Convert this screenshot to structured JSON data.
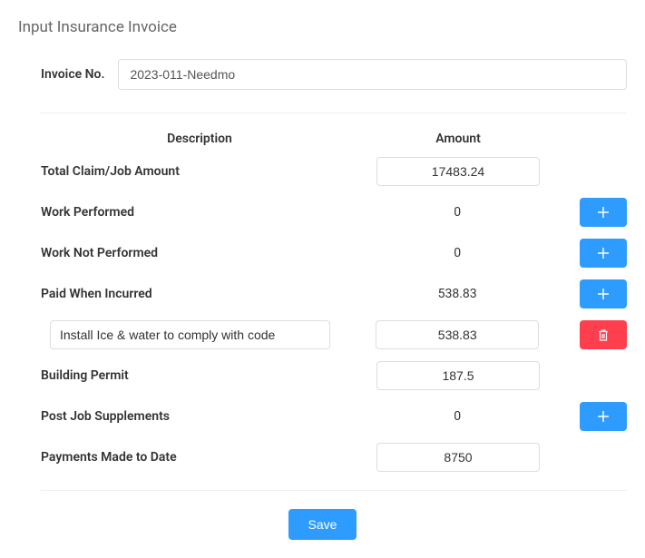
{
  "page_title": "Input Insurance Invoice",
  "invoice_no_label": "Invoice No.",
  "invoice_no_value": "2023-011-Needmo",
  "headers": {
    "description": "Description",
    "amount": "Amount"
  },
  "rows": {
    "total_claim": {
      "label": "Total Claim/Job Amount",
      "amount": "17483.24"
    },
    "work_performed": {
      "label": "Work Performed",
      "amount": "0"
    },
    "work_not_performed": {
      "label": "Work Not Performed",
      "amount": "0"
    },
    "paid_when_incurred": {
      "label": "Paid When Incurred",
      "amount": "538.83"
    },
    "building_permit": {
      "label": "Building Permit",
      "amount": "187.5"
    },
    "post_job_supplements": {
      "label": "Post Job Supplements",
      "amount": "0"
    },
    "payments_made": {
      "label": "Payments Made to Date",
      "amount": "8750"
    }
  },
  "sub_items": {
    "pwi_item1": {
      "description": "Install Ice & water to comply with code",
      "amount": "538.83"
    }
  },
  "buttons": {
    "save": "Save"
  }
}
